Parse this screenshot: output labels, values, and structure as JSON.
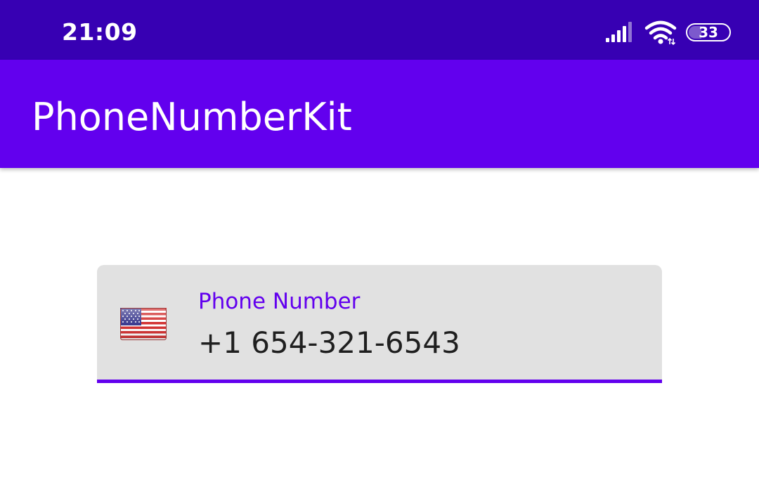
{
  "status_bar": {
    "time": "21:09",
    "battery_level": "33",
    "signal_icon": "cellular-signal-icon",
    "wifi_icon": "wifi-icon",
    "battery_icon": "battery-icon",
    "background_color": "#3700b3"
  },
  "app_bar": {
    "title": "PhoneNumberKit",
    "background_color": "#6200ee"
  },
  "phone_input": {
    "label": "Phone Number",
    "value": "+1 654-321-6543",
    "country_flag_icon": "us-flag-icon",
    "accent_color": "#6200ee",
    "field_background": "#e1e1e1"
  }
}
